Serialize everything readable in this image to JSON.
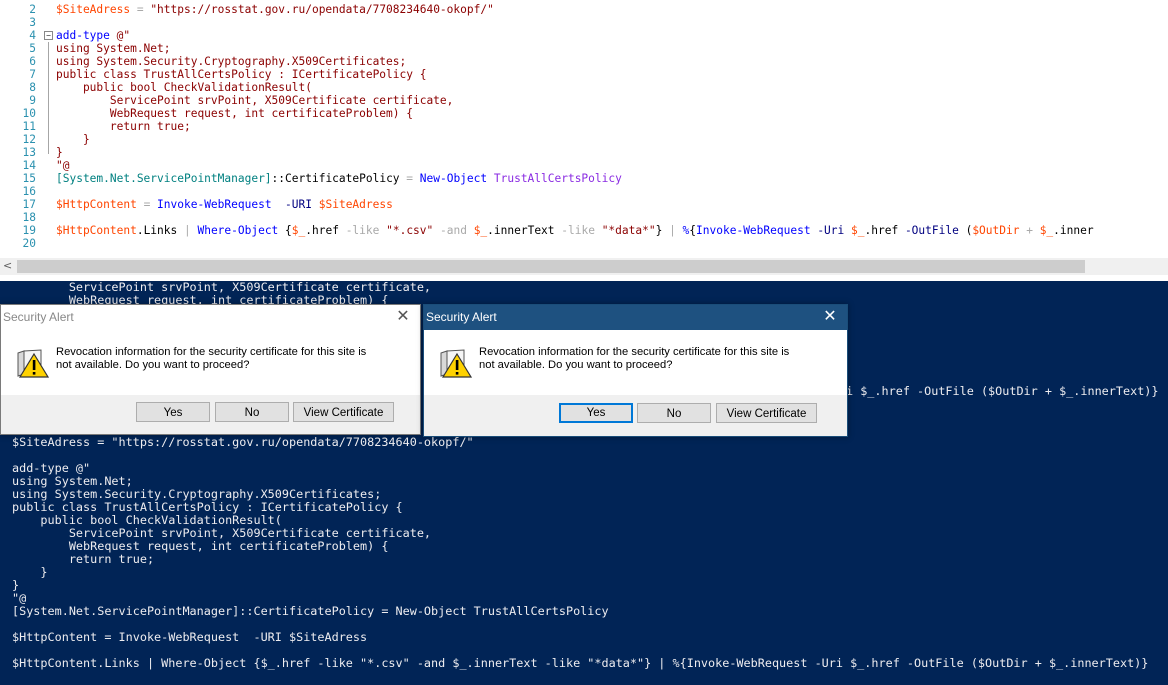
{
  "editor": {
    "lines": [
      {
        "num": "2",
        "tokens": [
          [
            "$SiteAdress",
            "var"
          ],
          [
            " = ",
            "op"
          ],
          [
            "\"https://rosstat.gov.ru/opendata/7708234640-okopf/\"",
            "str"
          ]
        ]
      },
      {
        "num": "3",
        "tokens": []
      },
      {
        "num": "4",
        "tokens": [
          [
            "add-type",
            "cmd"
          ],
          [
            " ",
            "plain"
          ],
          [
            "@\"",
            "str"
          ]
        ]
      },
      {
        "num": "5",
        "tokens": [
          [
            "using System.Net;",
            "str"
          ]
        ]
      },
      {
        "num": "6",
        "tokens": [
          [
            "using System.Security.Cryptography.X509Certificates;",
            "str"
          ]
        ]
      },
      {
        "num": "7",
        "tokens": [
          [
            "public class TrustAllCertsPolicy : ICertificatePolicy {",
            "str"
          ]
        ]
      },
      {
        "num": "8",
        "tokens": [
          [
            "    public bool CheckValidationResult(",
            "str"
          ]
        ]
      },
      {
        "num": "9",
        "tokens": [
          [
            "        ServicePoint srvPoint, X509Certificate certificate,",
            "str"
          ]
        ]
      },
      {
        "num": "10",
        "tokens": [
          [
            "        WebRequest request, int certificateProblem) {",
            "str"
          ]
        ]
      },
      {
        "num": "11",
        "tokens": [
          [
            "        return true;",
            "str"
          ]
        ]
      },
      {
        "num": "12",
        "tokens": [
          [
            "    }",
            "str"
          ]
        ]
      },
      {
        "num": "13",
        "tokens": [
          [
            "}",
            "str"
          ]
        ]
      },
      {
        "num": "14",
        "tokens": [
          [
            "\"@",
            "str"
          ]
        ]
      },
      {
        "num": "15",
        "tokens": [
          [
            "[System.Net.ServicePointManager]",
            "type"
          ],
          [
            "::",
            "plain"
          ],
          [
            "CertificatePolicy",
            "plain"
          ],
          [
            " = ",
            "op"
          ],
          [
            "New-Object",
            "cmd"
          ],
          [
            " ",
            "plain"
          ],
          [
            "TrustAllCertsPolicy",
            "arg"
          ]
        ]
      },
      {
        "num": "16",
        "tokens": []
      },
      {
        "num": "17",
        "tokens": [
          [
            "$HttpContent",
            "var"
          ],
          [
            " = ",
            "op"
          ],
          [
            "Invoke-WebRequest",
            "cmd"
          ],
          [
            "  ",
            "plain"
          ],
          [
            "-URI",
            "attr"
          ],
          [
            " ",
            "plain"
          ],
          [
            "$SiteAdress",
            "var"
          ]
        ]
      },
      {
        "num": "18",
        "tokens": []
      },
      {
        "num": "19",
        "tokens": [
          [
            "$HttpContent",
            "var"
          ],
          [
            ".Links",
            "plain"
          ],
          [
            " | ",
            "op"
          ],
          [
            "Where-Object",
            "cmd"
          ],
          [
            " {",
            "plain"
          ],
          [
            "$_",
            "var"
          ],
          [
            ".href",
            "plain"
          ],
          [
            " -like ",
            "op"
          ],
          [
            "\"*.csv\"",
            "str"
          ],
          [
            " -and ",
            "op"
          ],
          [
            "$_",
            "var"
          ],
          [
            ".innerText",
            "plain"
          ],
          [
            " -like ",
            "op"
          ],
          [
            "\"*data*\"",
            "str"
          ],
          [
            "}",
            "plain"
          ],
          [
            " | ",
            "op"
          ],
          [
            "%",
            "cmd"
          ],
          [
            "{",
            "plain"
          ],
          [
            "Invoke-WebRequest",
            "cmd"
          ],
          [
            " ",
            "plain"
          ],
          [
            "-Uri",
            "attr"
          ],
          [
            " ",
            "plain"
          ],
          [
            "$_",
            "var"
          ],
          [
            ".href",
            "plain"
          ],
          [
            " ",
            "plain"
          ],
          [
            "-OutFile",
            "attr"
          ],
          [
            " (",
            "plain"
          ],
          [
            "$OutDir",
            "var"
          ],
          [
            " + ",
            "op"
          ],
          [
            "$_",
            "var"
          ],
          [
            ".inner",
            "plain"
          ]
        ]
      },
      {
        "num": "20",
        "tokens": []
      }
    ],
    "scroll_left_arrow": "<"
  },
  "console": {
    "top_lines": [
      "        ServicePoint srvPoint, X509Certificate certificate,",
      "        WebRequest request, int certificateProblem) {"
    ],
    "fragment_line": "i $_.href -OutFile ($OutDir + $_.innerText)}",
    "lines": [
      "$SiteAdress = \"https://rosstat.gov.ru/opendata/7708234640-okopf/\"",
      "",
      "add-type @\"",
      "using System.Net;",
      "using System.Security.Cryptography.X509Certificates;",
      "public class TrustAllCertsPolicy : ICertificatePolicy {",
      "    public bool CheckValidationResult(",
      "        ServicePoint srvPoint, X509Certificate certificate,",
      "        WebRequest request, int certificateProblem) {",
      "        return true;",
      "    }",
      "}",
      "\"@",
      "[System.Net.ServicePointManager]::CertificatePolicy = New-Object TrustAllCertsPolicy",
      "",
      "$HttpContent = Invoke-WebRequest  -URI $SiteAdress",
      "",
      "$HttpContent.Links | Where-Object {$_.href -like \"*.csv\" -and $_.innerText -like \"*data*\"} | %{Invoke-WebRequest -Uri $_.href -OutFile ($OutDir + $_.innerText)}"
    ]
  },
  "dialogs": [
    {
      "title": "Security Alert",
      "close_glyph": "✕",
      "message": "Revocation information for the security certificate for this site is not available. Do you want to proceed?",
      "buttons": {
        "yes": "Yes",
        "no": "No",
        "view": "View Certificate"
      },
      "icon": "warning-shield-icon"
    },
    {
      "title": "Security Alert",
      "close_glyph": "✕",
      "message": "Revocation information for the security certificate for this site is not available. Do you want to proceed?",
      "buttons": {
        "yes": "Yes",
        "no": "No",
        "view": "View Certificate"
      },
      "icon": "warning-shield-icon"
    }
  ]
}
